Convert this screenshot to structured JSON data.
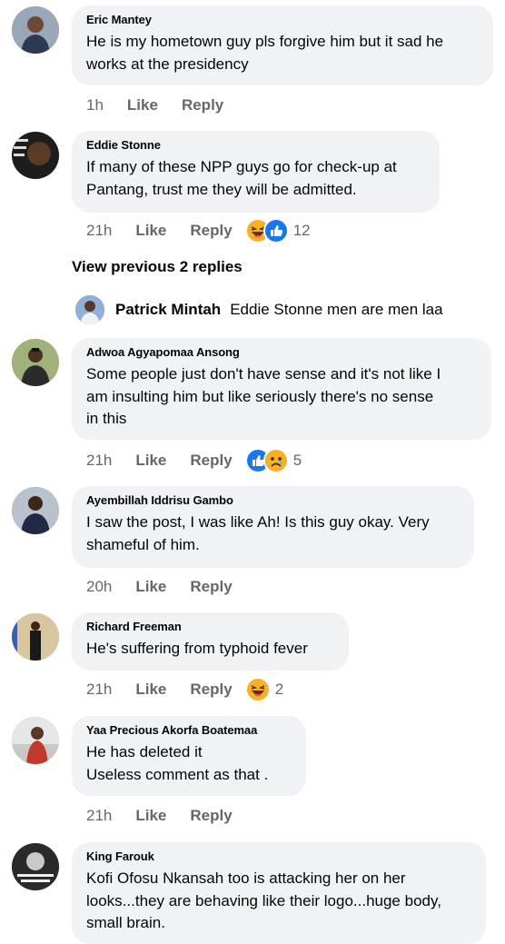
{
  "comments": [
    {
      "name": "Eric Mantey",
      "text": "He is my hometown guy pls forgive him but it sad he\nworks at the presidency",
      "time": "1h",
      "like": "Like",
      "reply": "Reply"
    },
    {
      "name": "Eddie Stonne",
      "text": "If many of these NPP guys go for check-up at\nPantang, trust me they will be admitted.",
      "time": "21h",
      "like": "Like",
      "reply": "Reply",
      "reactions": [
        "laughing-emoji-icon",
        "like-reaction-icon"
      ],
      "reaction_count": "12"
    },
    {
      "name": "Adwoa Agyapomaa Ansong",
      "text": "Some people just don't have sense and it's not like I\nam insulting him but like seriously there's no sense\nin this",
      "time": "21h",
      "like": "Like",
      "reply": "Reply",
      "reactions": [
        "like-reaction-icon",
        "sad-emoji-icon"
      ],
      "reaction_count": "5"
    },
    {
      "name": "Ayembillah Iddrisu Gambo",
      "text": "I saw the post, I was like Ah! Is this guy okay. Very\nshameful of him.",
      "time": "20h",
      "like": "Like",
      "reply": "Reply"
    },
    {
      "name": "Richard Freeman",
      "text": "He's suffering from typhoid fever",
      "time": "21h",
      "like": "Like",
      "reply": "Reply",
      "reactions": [
        "laughing-emoji-icon"
      ],
      "reaction_count": "2"
    },
    {
      "name": "Yaa Precious Akorfa Boatemaa",
      "text": "He has deleted it\nUseless comment as that .",
      "time": "21h",
      "like": "Like",
      "reply": "Reply"
    },
    {
      "name": "King Farouk",
      "text": "Kofi Ofosu Nkansah too is attacking her on her\nlooks...they are behaving like their logo...huge body,\nsmall brain."
    }
  ],
  "view_previous_replies": "View previous 2 replies",
  "inline_reply": {
    "name": "Patrick Mintah",
    "text": "Eddie Stonne men are men laa"
  },
  "colors": {
    "bubble": "#f0f2f5",
    "meta_text": "#65676b",
    "like_blue": "#1877f2",
    "haha_yellow": "#f7b125"
  }
}
